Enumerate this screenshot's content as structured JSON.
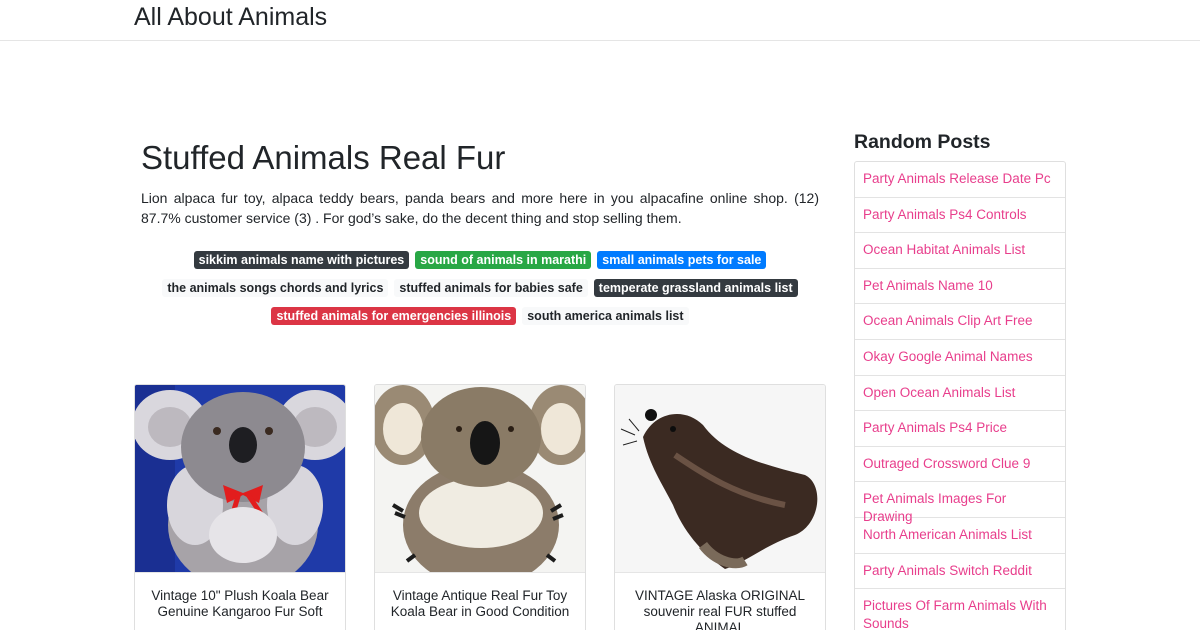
{
  "site": {
    "brand": "All About Animals"
  },
  "article": {
    "title": "Stuffed Animals Real Fur",
    "description": "Lion alpaca fur toy, alpaca teddy bears, panda bears and more here in you alpacafine online shop. (12) 87.7% customer service (3) . For god’s sake, do the decent thing and stop selling them."
  },
  "tags": [
    {
      "label": "sikkim animals name with pictures",
      "color": "#343a40"
    },
    {
      "label": "sound of animals in marathi",
      "color": "#28a745"
    },
    {
      "label": "small animals pets for sale",
      "color": "#007bff"
    },
    {
      "label": "the animals songs chords and lyrics",
      "color": "#f8f9fa"
    },
    {
      "label": "stuffed animals for babies safe",
      "color": "#f8f9fa"
    },
    {
      "label": "temperate grassland animals list",
      "color": "#343a40"
    },
    {
      "label": "stuffed animals for emergencies illinois",
      "color": "#dc3545"
    },
    {
      "label": "south america animals list",
      "color": "#f8f9fa"
    }
  ],
  "cards": [
    {
      "caption": "Vintage 10\" Plush Koala Bear Genuine Kangaroo Fur Soft",
      "image": "grey koala plush with red bow on blue background"
    },
    {
      "caption": "Vintage Antique Real Fur Toy Koala Bear in Good Condition",
      "image": "fur koala toy with white belly"
    },
    {
      "caption": "VINTAGE Alaska ORIGINAL souvenir real FUR stuffed ANIMAL",
      "image": "dark fur seal toy"
    }
  ],
  "sidebar": {
    "title": "Random Posts",
    "items": [
      "Party Animals Release Date Pc",
      "Party Animals Ps4 Controls",
      "Ocean Habitat Animals List",
      "Pet Animals Name 10",
      "Ocean Animals Clip Art Free",
      "Okay Google Animal Names",
      "Open Ocean Animals List",
      "Party Animals Ps4 Price",
      "Outraged Crossword Clue 9",
      "Pet Animals Images For Drawing",
      "North American Animals List",
      "Party Animals Switch Reddit",
      "Pictures Of Farm Animals With Sounds"
    ],
    "link_color": "#e83e8c"
  }
}
